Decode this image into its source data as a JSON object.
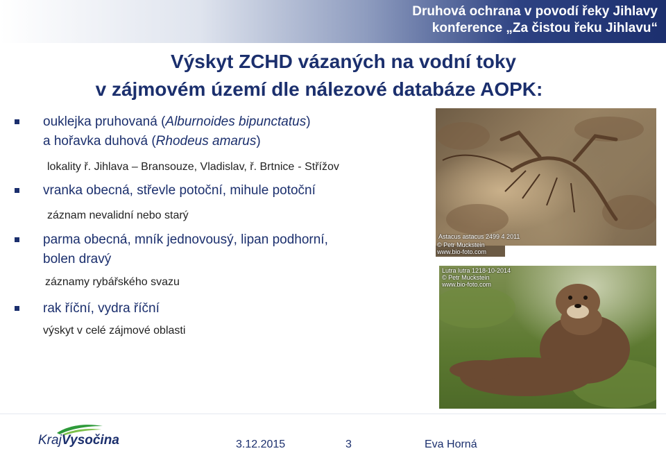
{
  "header": {
    "line1": "Druhová ochrana v povodí řeky Jihlavy",
    "line2": "konference „Za čistou řeku Jihlavu“"
  },
  "title": {
    "line1": "Výskyt ZCHD vázaných na vodní toky",
    "line2": "v zájmovém území dle nálezové databáze AOPK:"
  },
  "content": {
    "item1": {
      "line1_pre": "ouklejka pruhovaná (",
      "line1_latin": "Alburnoides bipunctatus",
      "line1_post": ")",
      "line2_pre": "a hořavka duhová (",
      "line2_latin": "Rhodeus amarus",
      "line2_post": ")",
      "sub_a": "lokality ř. Jihlava – Bransouze, Vladislav, ř. Brtnice",
      "sub_b": "- Střížov"
    },
    "item2": {
      "main": "vranka obecná, střevle potoční, mihule potoční",
      "sub": "záznam nevalidní nebo starý"
    },
    "item3": {
      "line1": "parma obecná, mník jednovousý, lipan podhorní,",
      "line2": "bolen dravý",
      "sub": "záznamy rybářského svazu"
    },
    "item4": {
      "main": "rak říční, vydra říční",
      "sub": "výskyt v celé zájmové oblasti"
    }
  },
  "images": {
    "crayfish": {
      "caption1": "Astacus astacus 2499 4 2011",
      "caption2": "© Petr Muckstein",
      "caption3": "www.bio-foto.com"
    },
    "otter": {
      "caption1": "Lutra lutra 1218-10-2014",
      "caption2": "© Petr Muckstein",
      "caption3": "www.bio-foto.com"
    }
  },
  "footer": {
    "logo_kraj": "Kraj",
    "logo_vysocina": "Vysočina",
    "date": "3.12.2015",
    "page": "3",
    "author": "Eva Horná"
  },
  "colors": {
    "text_blue": "#1b2f6d",
    "header_dark": "#1c2f6e",
    "logo_green": "#2e9a3a"
  }
}
